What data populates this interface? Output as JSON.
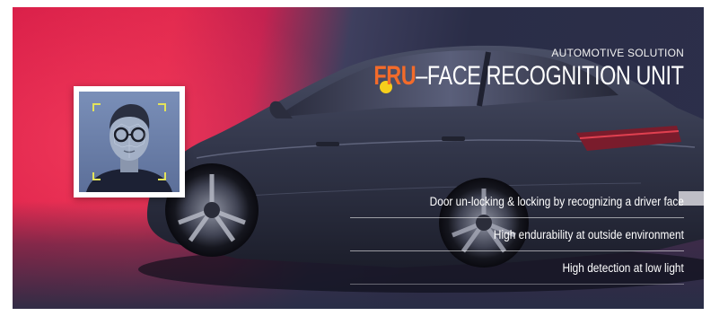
{
  "banner": {
    "eyebrow": "AUTOMOTIVE SOLUTION",
    "title_accent": "FRU",
    "title_rest": "–FACE RECOGNITION UNIT",
    "features": [
      "Door un-locking & locking by recognizing a driver face",
      "High endurability at outside environment",
      "High detection at low light"
    ],
    "colors": {
      "accent": "#f36b2a",
      "dot": "#f6cf1c",
      "background_left": "#d81e48",
      "background_right": "#2c2f4a"
    },
    "icons": [
      "face-scan-image",
      "sedan-car-image",
      "accent-dot"
    ]
  }
}
